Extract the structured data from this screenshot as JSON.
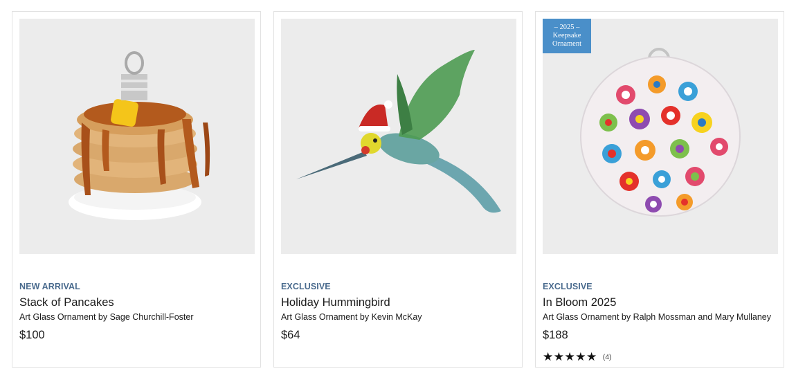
{
  "products": [
    {
      "tag": "NEW ARRIVAL",
      "title": "Stack of Pancakes",
      "subtitle": "Art Glass Ornament by Sage Churchill-Foster",
      "price": "$100",
      "image_icon": "pancake-ornament-image"
    },
    {
      "tag": "EXCLUSIVE",
      "title": "Holiday Hummingbird",
      "subtitle": "Art Glass Ornament by Kevin McKay",
      "price": "$64",
      "image_icon": "hummingbird-ornament-image"
    },
    {
      "tag": "EXCLUSIVE",
      "title": "In Bloom 2025",
      "subtitle": "Art Glass Ornament by Ralph Mossman and Mary Mullaney",
      "price": "$188",
      "image_icon": "millefiori-ornament-image",
      "badge": {
        "line1": "– 2025 –",
        "line2": "Keepsake",
        "line3": "Ornament"
      },
      "rating": {
        "stars": "★★★★★",
        "count": "(4)",
        "value": 5
      }
    }
  ],
  "colors": {
    "tag": "#4a6b8e",
    "badge_bg": "#4a8fc9",
    "card_border": "#e1e1e1",
    "image_bg": "#ececec"
  }
}
